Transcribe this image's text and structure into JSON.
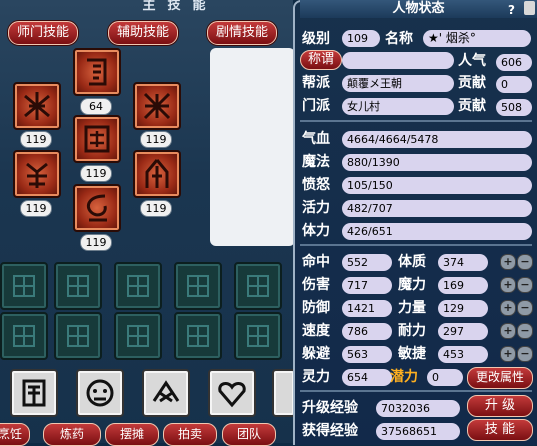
{
  "skill_window": {
    "title": "主技能",
    "tabs": [
      "师门技能",
      "辅助技能",
      "剧情技能"
    ],
    "skill_levels": [
      "64",
      "119",
      "119",
      "119",
      "119",
      "119",
      "119",
      "119"
    ],
    "bottom_buttons": [
      "烹饪",
      "炼药",
      "摆摊",
      "拍卖",
      "团队"
    ]
  },
  "status": {
    "title": "人物状态",
    "help": "?",
    "level_label": "级别",
    "level": "109",
    "name_label": "名称",
    "name": "★' 烟杀°",
    "title_btn": "称谓",
    "title_value": "",
    "popularity_label": "人气",
    "popularity": "606",
    "gang_label": "帮派",
    "gang": "颠覆メ王朝",
    "gang_contrib_label": "贡献",
    "gang_contrib": "0",
    "school_label": "门派",
    "school": "女儿村",
    "school_contrib_label": "贡献",
    "school_contrib": "508",
    "hp_label": "气血",
    "hp": "4664/4664/5478",
    "mp_label": "魔法",
    "mp": "880/1390",
    "anger_label": "愤怒",
    "anger": "105/150",
    "vitality_label": "活力",
    "vitality": "482/707",
    "stamina_label": "体力",
    "stamina": "426/651",
    "hit_label": "命中",
    "hit": "552",
    "con_label": "体质",
    "con": "374",
    "dmg_label": "伤害",
    "dmg": "717",
    "magic_label": "魔力",
    "magic": "169",
    "def_label": "防御",
    "def": "1421",
    "str_label": "力量",
    "str": "129",
    "spd_label": "速度",
    "spd": "786",
    "end_label": "耐力",
    "end": "297",
    "dodge_label": "躲避",
    "dodge": "563",
    "agi_label": "敏捷",
    "agi": "453",
    "spirit_label": "灵力",
    "spirit": "654",
    "potential_label": "潜力",
    "potential": "0",
    "change_attr_btn": "更改属性",
    "upgrade_exp_label": "升级经验",
    "upgrade_exp": "7032036",
    "upgrade_btn": "升 级",
    "gained_exp_label": "获得经验",
    "gained_exp": "37568651",
    "skill_btn": "技 能"
  },
  "colors": {
    "accent_red": "#a52422",
    "field_bg": "#d9d4ee",
    "potential_label": "#ffb020"
  }
}
